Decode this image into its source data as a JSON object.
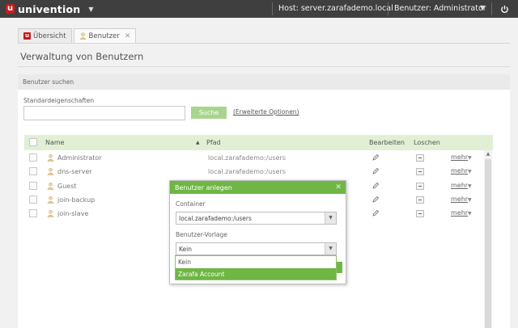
{
  "header": {
    "brand": "univention",
    "host": "Host: server.zarafademo.local",
    "user": "Benutzer: Administrator"
  },
  "tabs": [
    {
      "label": "Übersicht"
    },
    {
      "label": "Benutzer"
    }
  ],
  "page": {
    "title": "Verwaltung von Benutzern"
  },
  "search": {
    "section_title": "Benutzer suchen",
    "property_label": "Standardeigenschaften",
    "value": "",
    "button_label": "Suche",
    "advanced_link": "(Erweiterte Optionen)"
  },
  "grid": {
    "columns": {
      "name": "Name",
      "sort_indicator": "▲",
      "path": "Pfad",
      "edit": "Bearbeiten",
      "delete": "Loschen"
    },
    "more_label": "mehr",
    "rows": [
      {
        "name": "Administrator",
        "path": "local.zarafademo:/users"
      },
      {
        "name": "dns-server",
        "path": "local.zarafademo:/users"
      },
      {
        "name": "Guest",
        "path": ""
      },
      {
        "name": "join-backup",
        "path": ""
      },
      {
        "name": "join-slave",
        "path": ""
      }
    ]
  },
  "dialog": {
    "title": "Benutzer anlegen",
    "container_label": "Container",
    "container_value": "local.zarafademo:/users",
    "template_label": "Benutzer-Vorlage",
    "template_value": "Kein",
    "options": [
      "Kein",
      "Zarafa Account"
    ],
    "highlighted_option": "Zarafa Account"
  },
  "colors": {
    "brand_red": "#c81b1b",
    "accent_green": "#6fb644",
    "header_bg": "#3f3f3f"
  }
}
